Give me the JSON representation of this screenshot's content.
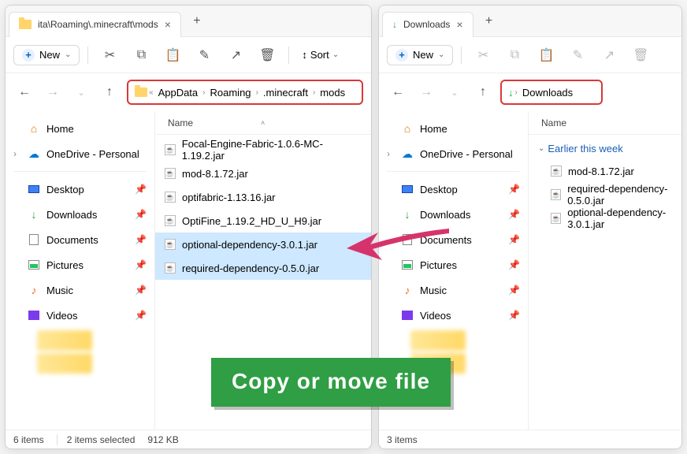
{
  "left": {
    "tab_title": "ita\\Roaming\\.minecraft\\mods",
    "new_label": "New",
    "sort_label": "Sort",
    "breadcrumb": [
      "AppData",
      "Roaming",
      ".minecraft",
      "mods"
    ],
    "bc_prefix": "«",
    "col_name": "Name",
    "files": [
      "Focal-Engine-Fabric-1.0.6-MC-1.19.2.jar",
      "mod-8.1.72.jar",
      "optifabric-1.13.16.jar",
      "OptiFine_1.19.2_HD_U_H9.jar",
      "optional-dependency-3.0.1.jar",
      "required-dependency-0.5.0.jar"
    ],
    "selected": [
      4,
      5
    ],
    "status_count": "6 items",
    "status_sel": "2 items selected",
    "status_size": "912 KB"
  },
  "right": {
    "tab_title": "Downloads",
    "new_label": "New",
    "breadcrumb": [
      "Downloads"
    ],
    "col_name": "Name",
    "group": "Earlier this week",
    "files": [
      "mod-8.1.72.jar",
      "required-dependency-0.5.0.jar",
      "optional-dependency-3.0.1.jar"
    ],
    "status_count": "3 items"
  },
  "sidebar": {
    "home": "Home",
    "onedrive": "OneDrive - Personal",
    "desktop": "Desktop",
    "downloads": "Downloads",
    "documents": "Documents",
    "pictures": "Pictures",
    "music": "Music",
    "videos": "Videos"
  },
  "banner_text": "Copy or move file"
}
